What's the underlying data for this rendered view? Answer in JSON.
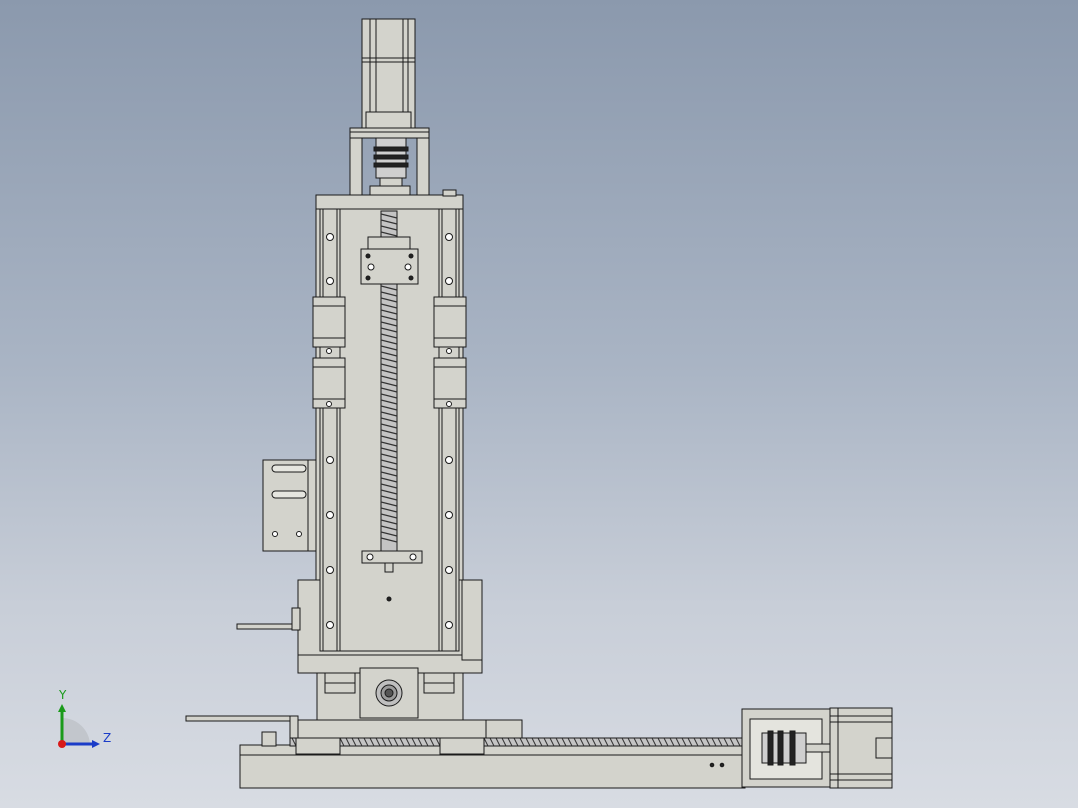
{
  "viewport": {
    "background_top": "#8b99ad",
    "background_bottom": "#d8dce3"
  },
  "model": {
    "part_color": "#d3d3cc",
    "edge_color": "#1a1a1a"
  },
  "triad": {
    "y_label": "Y",
    "z_label": "Z",
    "y_color": "#1a9a1a",
    "z_color": "#1a3cc8",
    "x_color": "#d81a1a"
  }
}
